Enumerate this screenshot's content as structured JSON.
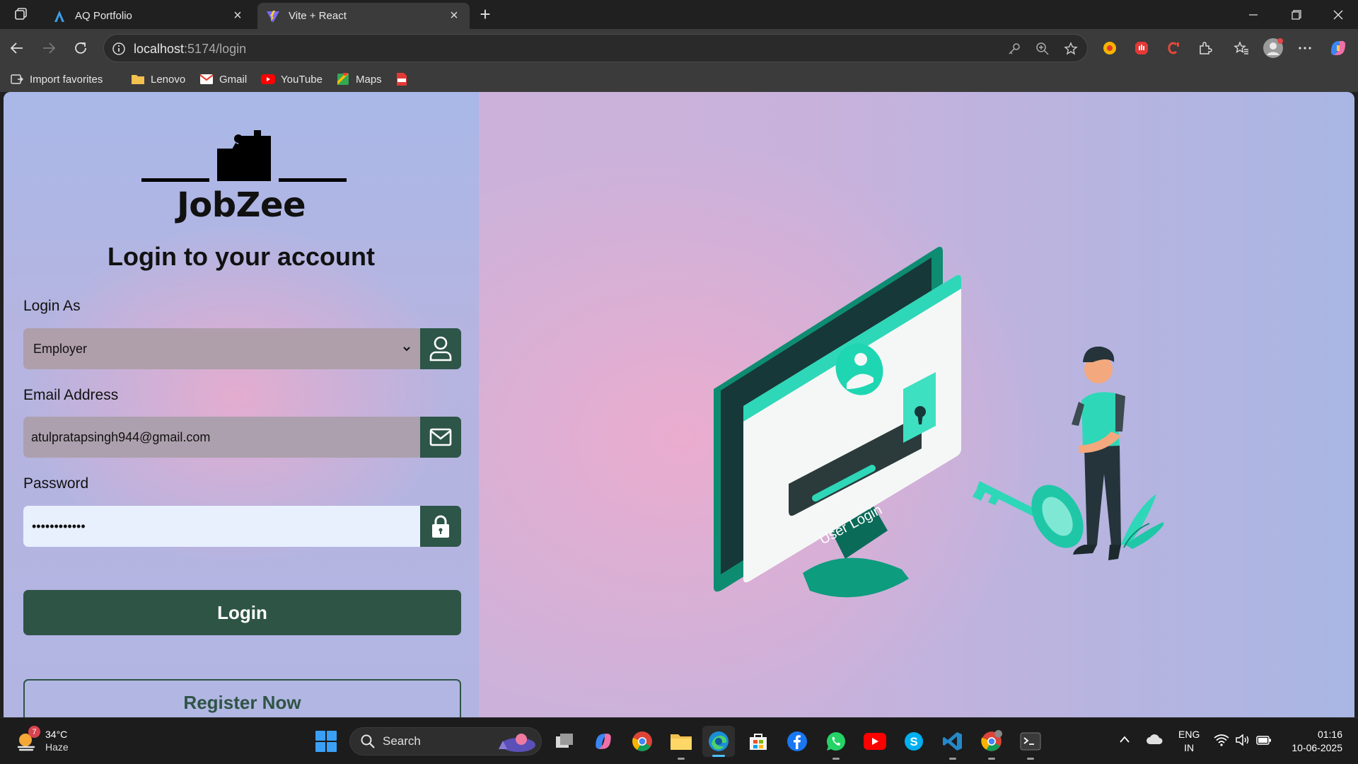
{
  "browser": {
    "tabs": [
      {
        "title": "AQ Portfolio",
        "favicon": "aq-portfolio-favicon-icon",
        "active": false
      },
      {
        "title": "Vite + React",
        "favicon": "vite-favicon-icon",
        "active": true
      }
    ],
    "address": {
      "host": "localhost",
      "path": ":5174/login"
    },
    "favorites": [
      {
        "label": "Import favorites",
        "icon": "import-icon"
      },
      {
        "label": "Lenovo",
        "icon": "folder-icon"
      },
      {
        "label": "Gmail",
        "icon": "gmail-icon"
      },
      {
        "label": "YouTube",
        "icon": "youtube-icon"
      },
      {
        "label": "Maps",
        "icon": "maps-icon"
      },
      {
        "label": "",
        "icon": "pdf-icon"
      }
    ]
  },
  "page": {
    "brand": "JobZee",
    "heading": "Login to your account",
    "role": {
      "label": "Login As",
      "value": "Employer",
      "icon": "user-icon"
    },
    "email": {
      "label": "Email Address",
      "value": "atulpratapsingh944@gmail.com",
      "icon": "mail-icon"
    },
    "password": {
      "label": "Password",
      "masked_value": "••••••••••••",
      "icon": "lock-icon"
    },
    "login_button": "Login",
    "register_button": "Register Now",
    "illustration": {
      "caption": "User Login"
    },
    "colors": {
      "accent": "#2e5446",
      "teal": "#1fd6b3"
    }
  },
  "taskbar": {
    "weather": {
      "temp": "34°C",
      "condition": "Haze",
      "badge": "7"
    },
    "search_placeholder": "Search",
    "lang": {
      "line1": "ENG",
      "line2": "IN"
    },
    "time": "01:16",
    "date": "10-06-2025"
  }
}
